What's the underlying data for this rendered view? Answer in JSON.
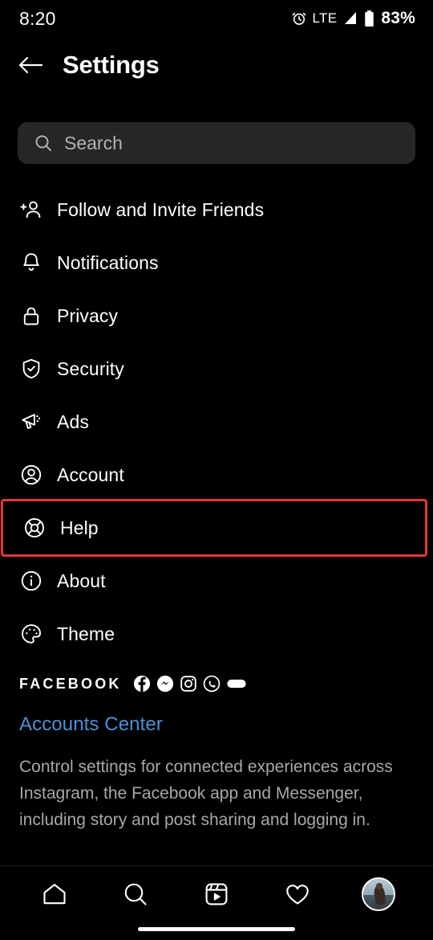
{
  "status_bar": {
    "time": "8:20",
    "alarm_icon": "alarm-clock-icon",
    "network_label": "LTE",
    "signal_icon": "signal-bars-icon",
    "battery_icon": "battery-icon",
    "battery_percent": "83%"
  },
  "header": {
    "back_icon": "back-arrow-icon",
    "title": "Settings"
  },
  "search": {
    "icon": "search-icon",
    "placeholder": "Search",
    "value": ""
  },
  "menu": {
    "items": [
      {
        "label": "Follow and Invite Friends",
        "icon": "person-add-icon",
        "highlighted": false
      },
      {
        "label": "Notifications",
        "icon": "bell-icon",
        "highlighted": false
      },
      {
        "label": "Privacy",
        "icon": "lock-icon",
        "highlighted": false
      },
      {
        "label": "Security",
        "icon": "shield-check-icon",
        "highlighted": false
      },
      {
        "label": "Ads",
        "icon": "megaphone-icon",
        "highlighted": false
      },
      {
        "label": "Account",
        "icon": "account-circle-icon",
        "highlighted": false
      },
      {
        "label": "Help",
        "icon": "lifebuoy-icon",
        "highlighted": true
      },
      {
        "label": "About",
        "icon": "info-circle-icon",
        "highlighted": false
      },
      {
        "label": "Theme",
        "icon": "palette-icon",
        "highlighted": false
      }
    ]
  },
  "facebook_section": {
    "brand_label": "FACEBOOK",
    "app_icons": [
      "facebook-icon",
      "messenger-icon",
      "instagram-icon",
      "whatsapp-icon",
      "oculus-icon"
    ],
    "link_label": "Accounts Center",
    "description": "Control settings for connected experiences across Instagram, the Facebook app and Messenger, including story and post sharing and logging in."
  },
  "bottom_nav": {
    "items": [
      {
        "name": "home",
        "icon": "home-icon"
      },
      {
        "name": "search",
        "icon": "search-icon"
      },
      {
        "name": "reels",
        "icon": "reels-icon"
      },
      {
        "name": "activity",
        "icon": "heart-icon"
      },
      {
        "name": "profile",
        "icon": "avatar-icon"
      }
    ]
  },
  "colors": {
    "background": "#000000",
    "highlight_border": "#e03a3e",
    "link_blue": "#4a90d9",
    "search_field": "#262626",
    "muted_text": "#a8a8a8"
  }
}
